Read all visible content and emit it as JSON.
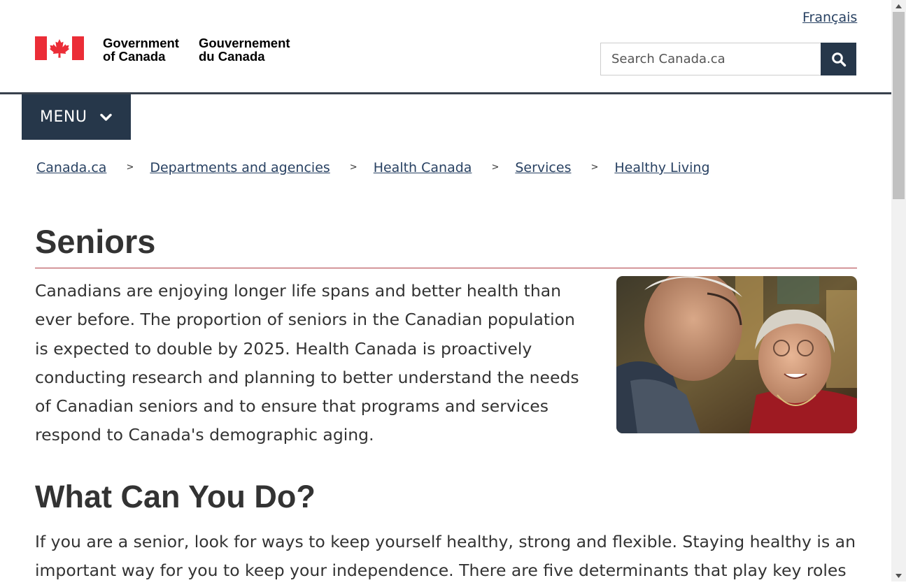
{
  "header": {
    "language_link": "Français",
    "brand_en_line1": "Government",
    "brand_en_line2": "of Canada",
    "brand_fr_line1": "Gouvernement",
    "brand_fr_line2": "du Canada",
    "search_placeholder": "Search Canada.ca",
    "menu_label": "MENU"
  },
  "breadcrumb": {
    "separator": ">",
    "items": [
      "Canada.ca",
      "Departments and agencies",
      "Health Canada",
      "Services",
      "Healthy Living"
    ]
  },
  "main": {
    "title": "Seniors",
    "intro": "Canadians are enjoying longer life spans and better health than ever before. The proportion of seniors in the Canadian population is expected to double by 2025. Health Canada is proactively conducting research and planning to better understand the needs of Canadian seniors and to ensure that programs and services respond to Canada's demographic aging.",
    "section_heading": "What Can You Do?",
    "section_text": "If you are a senior, look for ways to keep yourself healthy, strong and flexible. Staying healthy is an important way for you to keep your independence. There are five determinants that play key roles"
  },
  "colors": {
    "flag_red": "#eb2d37",
    "nav_dark": "#26374a",
    "link": "#284162",
    "title_rule": "#af3c43"
  },
  "icons": {
    "search": "search-icon",
    "menu": "chevron-down-icon",
    "flag": "canada-flag-icon"
  }
}
